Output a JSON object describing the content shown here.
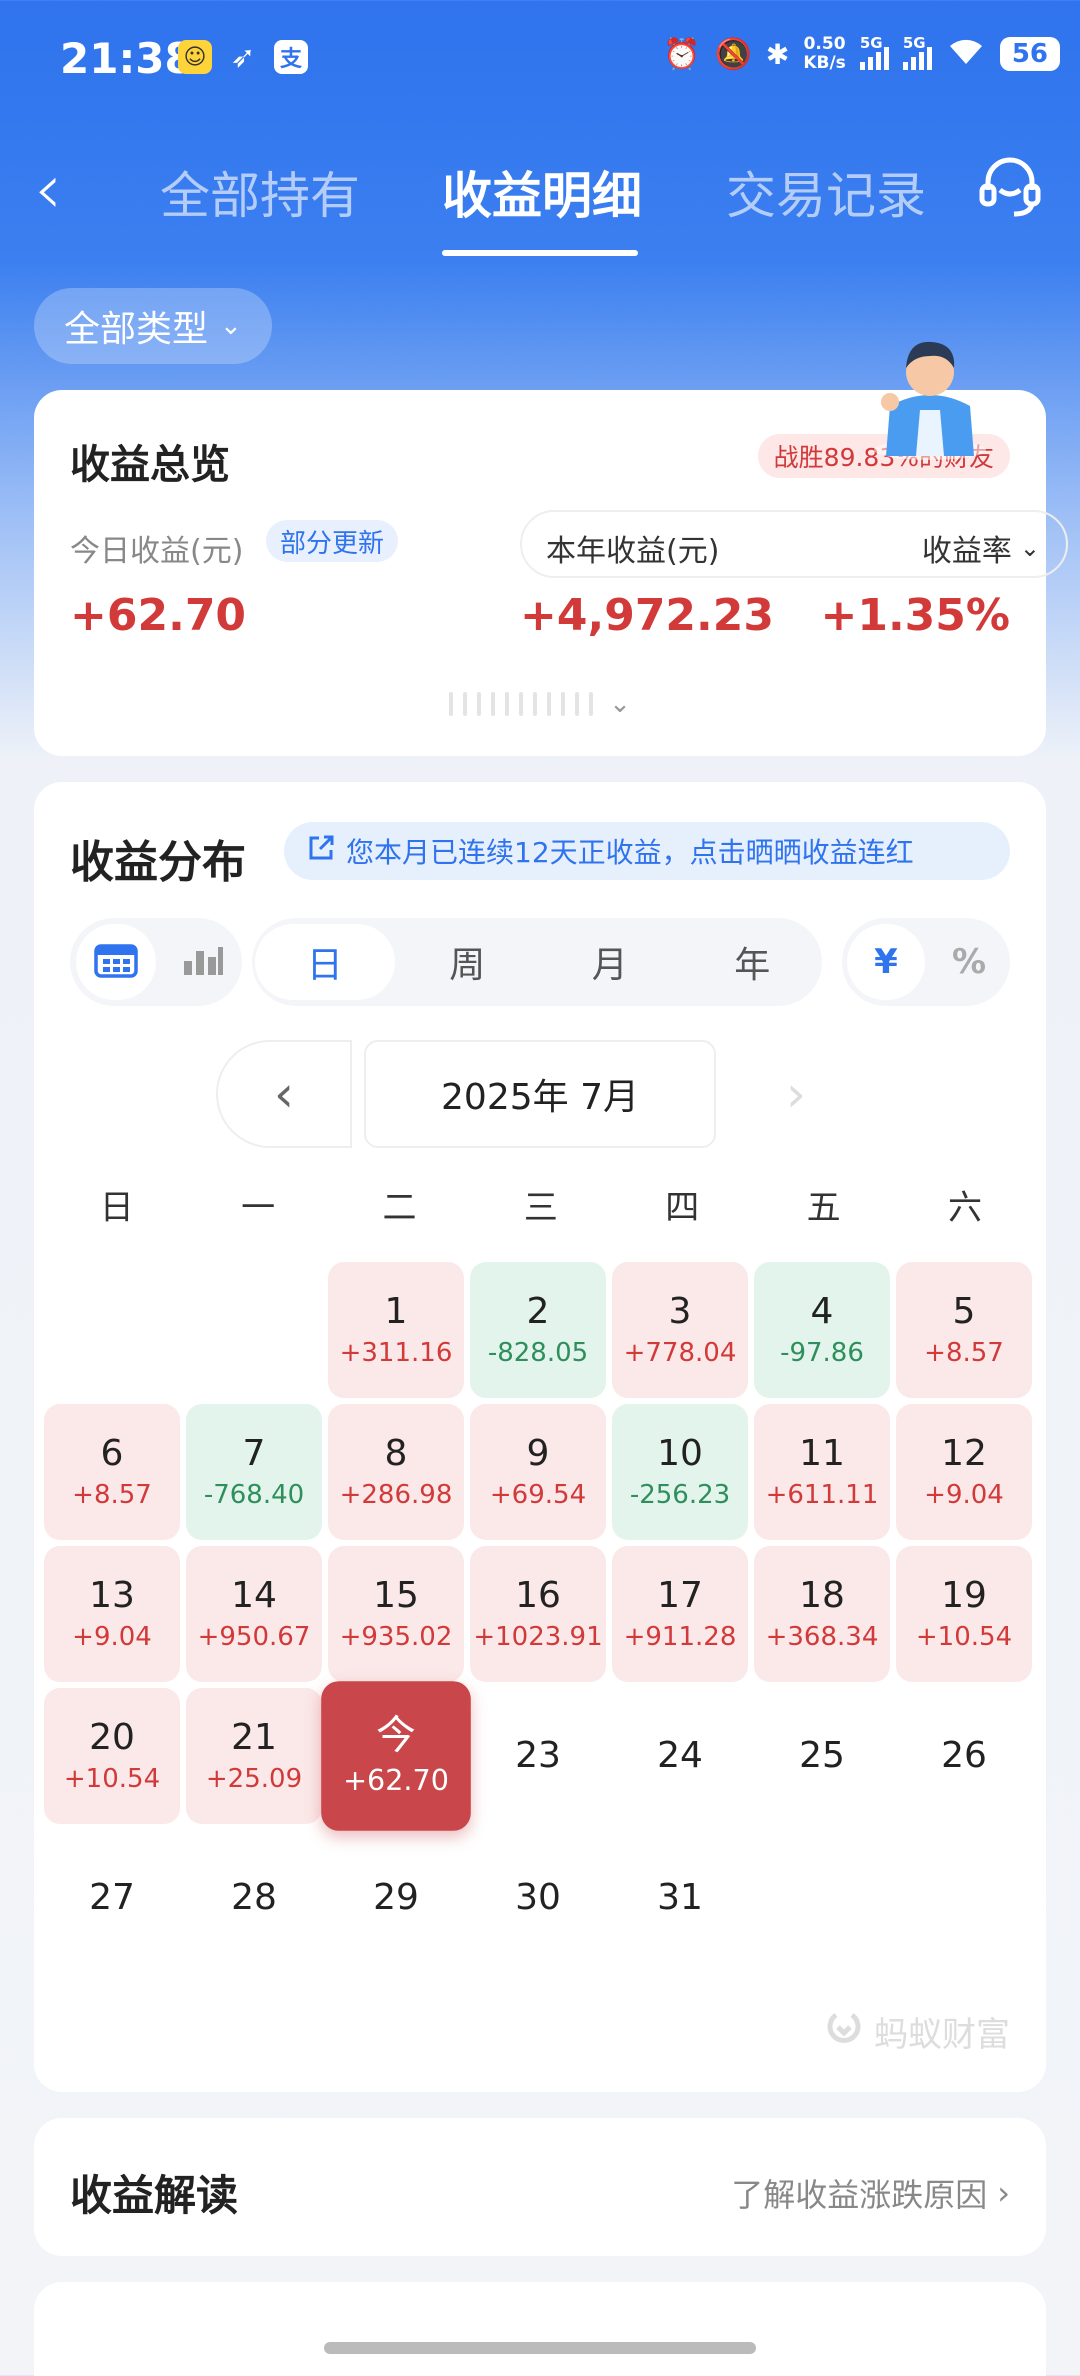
{
  "status_bar": {
    "time": "21:38",
    "app_icons": [
      "face-icon",
      "bird-icon",
      "alipay-icon"
    ],
    "alipay_glyph": "支",
    "net_speed_value": "0.50",
    "net_speed_unit": "KB/s",
    "signal_label": "5G",
    "battery": "56"
  },
  "nav": {
    "tabs": [
      "全部持有",
      "收益明细",
      "交易记录"
    ],
    "active_tab": "收益明细"
  },
  "filter": {
    "label": "全部类型"
  },
  "overview": {
    "title": "收益总览",
    "win_badge": "战胜89.83%的财友",
    "today_label": "今日收益(元)",
    "partial_update": "部分更新",
    "today_value": "+62.70",
    "year_label": "本年收益(元)",
    "rate_label": "收益率",
    "year_value": "+4,972.23",
    "rate_value": "+1.35%"
  },
  "distribution": {
    "title": "收益分布",
    "streak_banner": "您本月已连续12天正收益，点击晒晒收益连红",
    "periods": [
      "日",
      "周",
      "月",
      "年"
    ],
    "active_period": "日",
    "units": [
      "¥",
      "%"
    ],
    "active_unit": "¥",
    "month_label": "2025年 7月",
    "weekdays": [
      "日",
      "一",
      "二",
      "三",
      "四",
      "五",
      "六"
    ],
    "leading_blanks": 2,
    "days": [
      {
        "day": "1",
        "value": "+311.16",
        "trend": "up"
      },
      {
        "day": "2",
        "value": "-828.05",
        "trend": "down"
      },
      {
        "day": "3",
        "value": "+778.04",
        "trend": "up"
      },
      {
        "day": "4",
        "value": "-97.86",
        "trend": "down"
      },
      {
        "day": "5",
        "value": "+8.57",
        "trend": "up"
      },
      {
        "day": "6",
        "value": "+8.57",
        "trend": "up"
      },
      {
        "day": "7",
        "value": "-768.40",
        "trend": "down"
      },
      {
        "day": "8",
        "value": "+286.98",
        "trend": "up"
      },
      {
        "day": "9",
        "value": "+69.54",
        "trend": "up"
      },
      {
        "day": "10",
        "value": "-256.23",
        "trend": "down"
      },
      {
        "day": "11",
        "value": "+611.11",
        "trend": "up"
      },
      {
        "day": "12",
        "value": "+9.04",
        "trend": "up"
      },
      {
        "day": "13",
        "value": "+9.04",
        "trend": "up"
      },
      {
        "day": "14",
        "value": "+950.67",
        "trend": "up"
      },
      {
        "day": "15",
        "value": "+935.02",
        "trend": "up"
      },
      {
        "day": "16",
        "value": "+1023.91",
        "trend": "up"
      },
      {
        "day": "17",
        "value": "+911.28",
        "trend": "up"
      },
      {
        "day": "18",
        "value": "+368.34",
        "trend": "up"
      },
      {
        "day": "19",
        "value": "+10.54",
        "trend": "up"
      },
      {
        "day": "20",
        "value": "+10.54",
        "trend": "up"
      },
      {
        "day": "21",
        "value": "+25.09",
        "trend": "up"
      },
      {
        "day": "今",
        "value": "+62.70",
        "trend": "today"
      },
      {
        "day": "23",
        "value": "",
        "trend": "none"
      },
      {
        "day": "24",
        "value": "",
        "trend": "none"
      },
      {
        "day": "25",
        "value": "",
        "trend": "none"
      },
      {
        "day": "26",
        "value": "",
        "trend": "none"
      },
      {
        "day": "27",
        "value": "",
        "trend": "none"
      },
      {
        "day": "28",
        "value": "",
        "trend": "none"
      },
      {
        "day": "29",
        "value": "",
        "trend": "none"
      },
      {
        "day": "30",
        "value": "",
        "trend": "none"
      },
      {
        "day": "31",
        "value": "",
        "trend": "none"
      }
    ],
    "watermark": "蚂蚁财富"
  },
  "interpret": {
    "title": "收益解读",
    "link": "了解收益涨跌原因"
  },
  "colors": {
    "brand_blue": "#2f73ee",
    "gain_red": "#d23a3a",
    "loss_green": "#2f8f5c",
    "today_red": "#c9474a"
  }
}
